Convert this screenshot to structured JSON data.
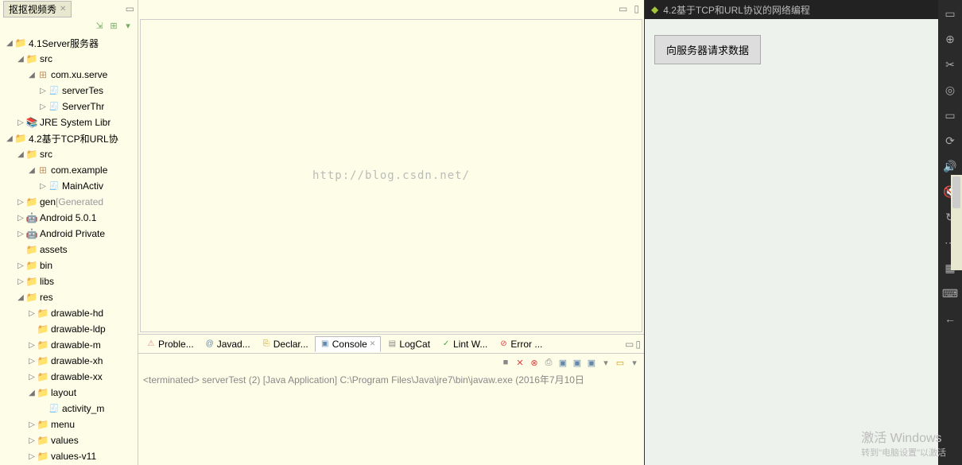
{
  "explorer": {
    "tab_label": "抠抠视频秀",
    "toolbar": {
      "collapse": "⇲",
      "link": "⊞",
      "menu": "▾"
    },
    "tree": [
      {
        "indent": 0,
        "tw": "◢",
        "icon": "proj",
        "label": "4.1Server服务器"
      },
      {
        "indent": 1,
        "tw": "◢",
        "icon": "folder",
        "label": "src"
      },
      {
        "indent": 2,
        "tw": "◢",
        "icon": "pkg",
        "label": "com.xu.serve"
      },
      {
        "indent": 3,
        "tw": "▷",
        "icon": "java",
        "label": "serverTes"
      },
      {
        "indent": 3,
        "tw": "▷",
        "icon": "java",
        "label": "ServerThr"
      },
      {
        "indent": 1,
        "tw": "▷",
        "icon": "lib",
        "label": "JRE System Libr"
      },
      {
        "indent": 0,
        "tw": "◢",
        "icon": "proj",
        "label": "4.2基于TCP和URL协"
      },
      {
        "indent": 1,
        "tw": "◢",
        "icon": "folder",
        "label": "src"
      },
      {
        "indent": 2,
        "tw": "◢",
        "icon": "pkg",
        "label": "com.example"
      },
      {
        "indent": 3,
        "tw": "▷",
        "icon": "java",
        "label": "MainActiv"
      },
      {
        "indent": 1,
        "tw": "▷",
        "icon": "folder",
        "label": "gen",
        "suffix": "[Generated"
      },
      {
        "indent": 1,
        "tw": "▷",
        "icon": "android",
        "label": "Android 5.0.1"
      },
      {
        "indent": 1,
        "tw": "▷",
        "icon": "android",
        "label": "Android Private"
      },
      {
        "indent": 1,
        "tw": "",
        "icon": "folder",
        "label": "assets"
      },
      {
        "indent": 1,
        "tw": "▷",
        "icon": "folder",
        "label": "bin"
      },
      {
        "indent": 1,
        "tw": "▷",
        "icon": "folder",
        "label": "libs"
      },
      {
        "indent": 1,
        "tw": "◢",
        "icon": "folder",
        "label": "res"
      },
      {
        "indent": 2,
        "tw": "▷",
        "icon": "folder",
        "label": "drawable-hd"
      },
      {
        "indent": 2,
        "tw": "",
        "icon": "folder",
        "label": "drawable-ldp"
      },
      {
        "indent": 2,
        "tw": "▷",
        "icon": "folder",
        "label": "drawable-m"
      },
      {
        "indent": 2,
        "tw": "▷",
        "icon": "folder",
        "label": "drawable-xh"
      },
      {
        "indent": 2,
        "tw": "▷",
        "icon": "folder",
        "label": "drawable-xx"
      },
      {
        "indent": 2,
        "tw": "◢",
        "icon": "folder",
        "label": "layout"
      },
      {
        "indent": 3,
        "tw": "",
        "icon": "java",
        "label": "activity_m"
      },
      {
        "indent": 2,
        "tw": "▷",
        "icon": "folder",
        "label": "menu"
      },
      {
        "indent": 2,
        "tw": "▷",
        "icon": "folder",
        "label": "values"
      },
      {
        "indent": 2,
        "tw": "▷",
        "icon": "folder",
        "label": "values-v11"
      }
    ]
  },
  "editor": {
    "watermark": "http://blog.csdn.net/"
  },
  "bottom": {
    "tabs": [
      {
        "label": "Proble...",
        "icon": "⚠",
        "color": "#d88"
      },
      {
        "label": "Javad...",
        "icon": "@",
        "color": "#68a"
      },
      {
        "label": "Declar...",
        "icon": "⎘",
        "color": "#c90"
      },
      {
        "label": "Console",
        "icon": "▣",
        "color": "#68a",
        "active": true,
        "closable": true
      },
      {
        "label": "LogCat",
        "icon": "▤",
        "color": "#888"
      },
      {
        "label": "Lint W...",
        "icon": "✓",
        "color": "#4a4"
      },
      {
        "label": "Error ...",
        "icon": "⊘",
        "color": "#d44"
      }
    ],
    "toolbar_icons": [
      "■",
      "✕",
      "⊗",
      "⎙",
      "▣",
      "▣",
      "▣",
      "▾",
      "▭",
      "▾"
    ],
    "console_status": "<terminated> serverTest (2) [Java Application] C:\\Program Files\\Java\\jre7\\bin\\javaw.exe (2016年7月10日"
  },
  "emulator": {
    "title": "4.2基于TCP和URL协议的网络编程",
    "button_label": "向服务器请求数据"
  },
  "rail_icons": [
    "▭",
    "⊕",
    "✂",
    "◎",
    "▭",
    "⟳",
    "🔊",
    "🔇",
    "↻",
    "⋯",
    "▦",
    "⌨",
    "←"
  ],
  "activation": {
    "line1": "激活 Windows",
    "line2": "转到\"电脑设置\"以激活"
  }
}
